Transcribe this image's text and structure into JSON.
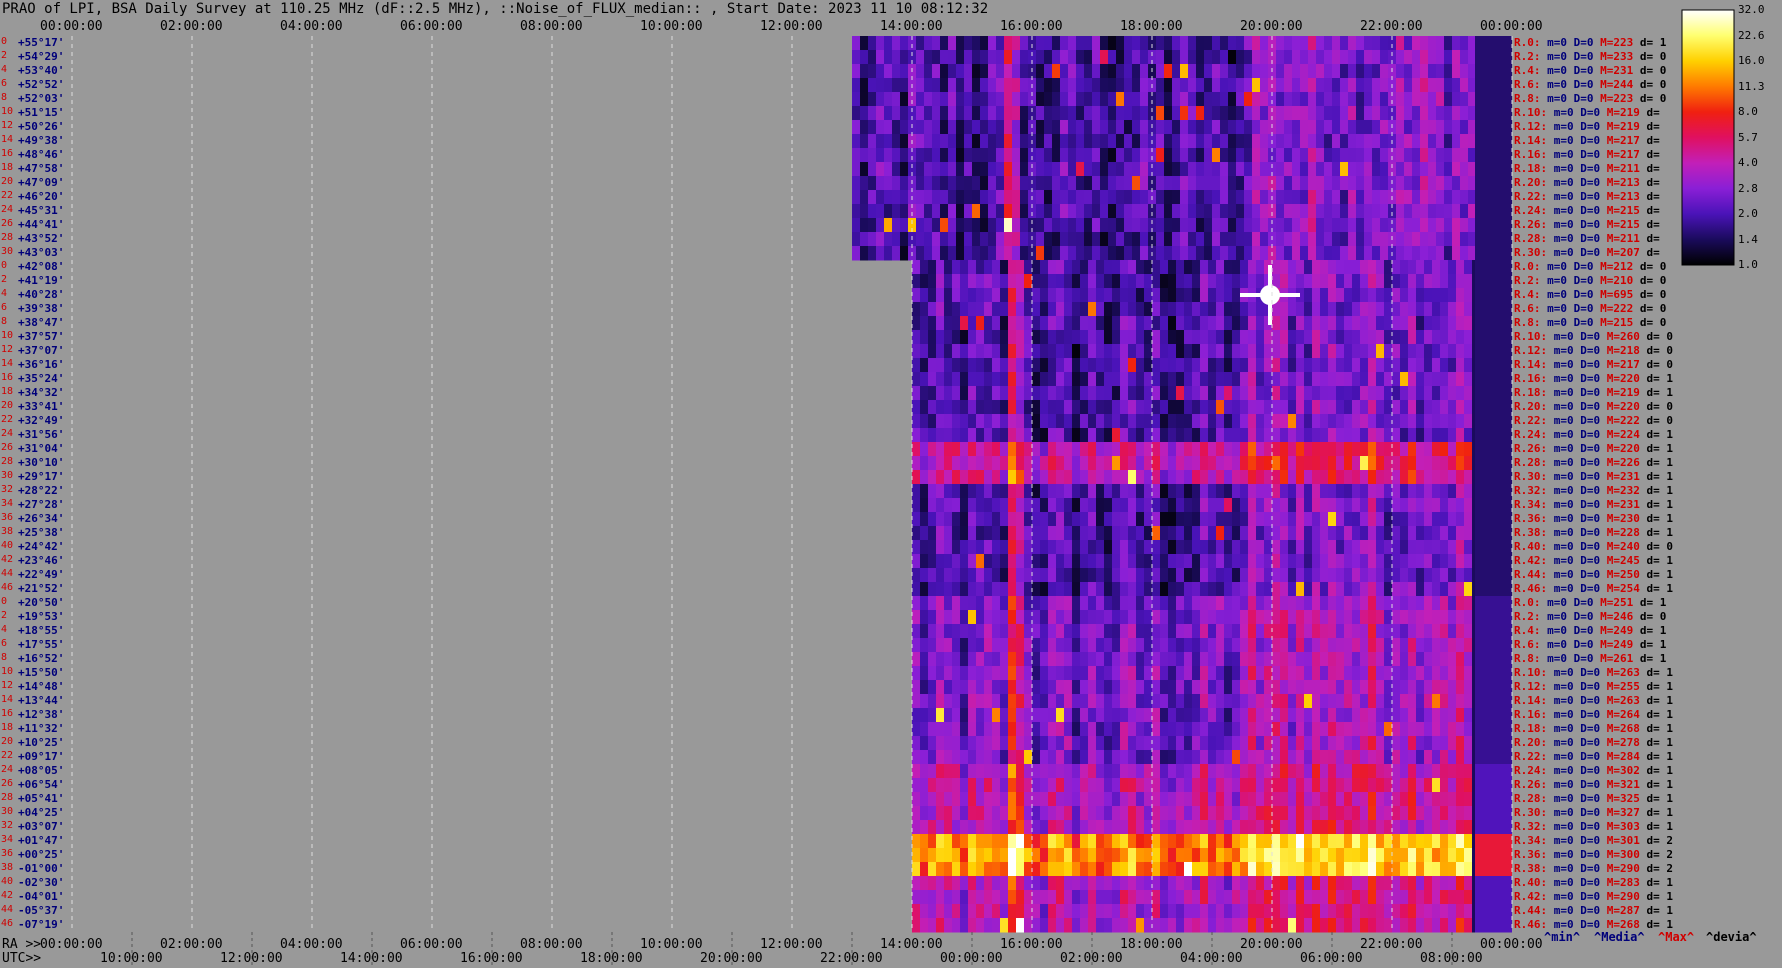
{
  "title": "PRAO of LPI, BSA Daily Survey at 110.25 MHz (dF::2.5 MHz), ::Noise_of_FLUX_median:: , Start Date: 2023 11 10 08:12:32",
  "x_axis": {
    "row1_prefix": "RA >>",
    "row2_prefix": "UTC>>",
    "top_ticks": [
      "00:00:00",
      "02:00:00",
      "04:00:00",
      "06:00:00",
      "08:00:00",
      "10:00:00",
      "12:00:00",
      "14:00:00",
      "16:00:00",
      "18:00:00",
      "20:00:00",
      "22:00:00",
      "00:00:00"
    ],
    "bottom_ra_ticks": [
      "00:00:00",
      "02:00:00",
      "04:00:00",
      "06:00:00",
      "08:00:00",
      "10:00:00",
      "12:00:00",
      "14:00:00",
      "16:00:00",
      "18:00:00",
      "20:00:00",
      "22:00:00",
      "00:00:00"
    ],
    "utc_ticks": [
      "10:00:00",
      "12:00:00",
      "14:00:00",
      "16:00:00",
      "18:00:00",
      "20:00:00",
      "22:00:00",
      "00:00:00",
      "02:00:00",
      "04:00:00",
      "06:00:00",
      "08:00:00"
    ]
  },
  "colorbar": {
    "labels": [
      "32.0",
      "22.6",
      "16.0",
      "11.3",
      "8.0",
      "5.7",
      "4.0",
      "2.8",
      "2.0",
      "1.4",
      "1.0"
    ],
    "stops": [
      "#000000",
      "#1a0b5c",
      "#4a13b8",
      "#8a1fd6",
      "#c21fb8",
      "#e01060",
      "#f02010",
      "#ff7a00",
      "#ffd000",
      "#ffff70",
      "#ffffff"
    ]
  },
  "legend": [
    {
      "text": "^min^",
      "color": "#00007a"
    },
    {
      "text": "^Media^",
      "color": "#00007a"
    },
    {
      "text": "^Max^",
      "color": "#d00000"
    },
    {
      "text": "^devia^",
      "color": "#000000"
    }
  ],
  "chart_data": {
    "type": "heatmap",
    "title": "PRAO of LPI, BSA Daily Survey at 110.25 MHz (dF::2.5 MHz), ::Noise_of_FLUX_median:: , Start Date: 2023 11 10 08:12:32",
    "x_axis": "RA (hh:mm:ss), 00:00:00 to 24:00:00; UTC 08:12:32 (2023-11-10) to 08:12:32 next day",
    "data_start_ra": [
      "13:05:00",
      "14:00:00"
    ],
    "value_range": [
      1.0,
      32.0
    ],
    "colorbar_scale": "log2",
    "rows": [
      {
        "idx": "0",
        "dec": "+55°17'",
        "label": "R.0:",
        "min": 0,
        "med": 0,
        "max": 223,
        "dev": 1
      },
      {
        "idx": "2",
        "dec": "+54°29'",
        "label": "R.2:",
        "min": 0,
        "med": 0,
        "max": 233,
        "dev": 0
      },
      {
        "idx": "4",
        "dec": "+53°40'",
        "label": "R.4:",
        "min": 0,
        "med": 0,
        "max": 231,
        "dev": 0
      },
      {
        "idx": "6",
        "dec": "+52°52'",
        "label": "R.6:",
        "min": 0,
        "med": 0,
        "max": 244,
        "dev": 0
      },
      {
        "idx": "8",
        "dec": "+52°03'",
        "label": "R.8:",
        "min": 0,
        "med": 0,
        "max": 223,
        "dev": 0
      },
      {
        "idx": "10",
        "dec": "+51°15'",
        "label": "R.10:",
        "min": 0,
        "med": 0,
        "max": 219,
        "dev": ""
      },
      {
        "idx": "12",
        "dec": "+50°26'",
        "label": "R.12:",
        "min": 0,
        "med": 0,
        "max": 219,
        "dev": ""
      },
      {
        "idx": "14",
        "dec": "+49°38'",
        "label": "R.14:",
        "min": 0,
        "med": 0,
        "max": 217,
        "dev": ""
      },
      {
        "idx": "16",
        "dec": "+48°46'",
        "label": "R.16:",
        "min": 0,
        "med": 0,
        "max": 217,
        "dev": ""
      },
      {
        "idx": "18",
        "dec": "+47°58'",
        "label": "R.18:",
        "min": 0,
        "med": 0,
        "max": 211,
        "dev": ""
      },
      {
        "idx": "20",
        "dec": "+47°09'",
        "label": "R.20:",
        "min": 0,
        "med": 0,
        "max": 213,
        "dev": ""
      },
      {
        "idx": "22",
        "dec": "+46°20'",
        "label": "R.22:",
        "min": 0,
        "med": 0,
        "max": 213,
        "dev": ""
      },
      {
        "idx": "24",
        "dec": "+45°31'",
        "label": "R.24:",
        "min": 0,
        "med": 0,
        "max": 215,
        "dev": ""
      },
      {
        "idx": "26",
        "dec": "+44°41'",
        "label": "R.26:",
        "min": 0,
        "med": 0,
        "max": 215,
        "dev": ""
      },
      {
        "idx": "28",
        "dec": "+43°52'",
        "label": "R.28:",
        "min": 0,
        "med": 0,
        "max": 211,
        "dev": ""
      },
      {
        "idx": "30",
        "dec": "+43°03'",
        "label": "R.30:",
        "min": 0,
        "med": 0,
        "max": 207,
        "dev": ""
      },
      {
        "idx": "0",
        "dec": "+42°08'",
        "label": "R.0:",
        "min": 0,
        "med": 0,
        "max": 212,
        "dev": 0
      },
      {
        "idx": "2",
        "dec": "+41°19'",
        "label": "R.2:",
        "min": 0,
        "med": 0,
        "max": 210,
        "dev": 0
      },
      {
        "idx": "4",
        "dec": "+40°28'",
        "label": "R.4:",
        "min": 0,
        "med": 0,
        "max": 695,
        "dev": 0
      },
      {
        "idx": "6",
        "dec": "+39°38'",
        "label": "R.6:",
        "min": 0,
        "med": 0,
        "max": 222,
        "dev": 0
      },
      {
        "idx": "8",
        "dec": "+38°47'",
        "label": "R.8:",
        "min": 0,
        "med": 0,
        "max": 215,
        "dev": 0
      },
      {
        "idx": "10",
        "dec": "+37°57'",
        "label": "R.10:",
        "min": 0,
        "med": 0,
        "max": 260,
        "dev": 0
      },
      {
        "idx": "12",
        "dec": "+37°07'",
        "label": "R.12:",
        "min": 0,
        "med": 0,
        "max": 218,
        "dev": 0
      },
      {
        "idx": "14",
        "dec": "+36°16'",
        "label": "R.14:",
        "min": 0,
        "med": 0,
        "max": 217,
        "dev": 0
      },
      {
        "idx": "16",
        "dec": "+35°24'",
        "label": "R.16:",
        "min": 0,
        "med": 0,
        "max": 220,
        "dev": 1
      },
      {
        "idx": "18",
        "dec": "+34°32'",
        "label": "R.18:",
        "min": 0,
        "med": 0,
        "max": 219,
        "dev": 1
      },
      {
        "idx": "20",
        "dec": "+33°41'",
        "label": "R.20:",
        "min": 0,
        "med": 0,
        "max": 220,
        "dev": 0
      },
      {
        "idx": "22",
        "dec": "+32°49'",
        "label": "R.22:",
        "min": 0,
        "med": 0,
        "max": 222,
        "dev": 0
      },
      {
        "idx": "24",
        "dec": "+31°56'",
        "label": "R.24:",
        "min": 0,
        "med": 0,
        "max": 224,
        "dev": 1
      },
      {
        "idx": "26",
        "dec": "+31°04'",
        "label": "R.26:",
        "min": 0,
        "med": 0,
        "max": 220,
        "dev": 1
      },
      {
        "idx": "28",
        "dec": "+30°10'",
        "label": "R.28:",
        "min": 0,
        "med": 0,
        "max": 226,
        "dev": 1
      },
      {
        "idx": "30",
        "dec": "+29°17'",
        "label": "R.30:",
        "min": 0,
        "med": 0,
        "max": 231,
        "dev": 1
      },
      {
        "idx": "32",
        "dec": "+28°22'",
        "label": "R.32:",
        "min": 0,
        "med": 0,
        "max": 232,
        "dev": 1
      },
      {
        "idx": "34",
        "dec": "+27°28'",
        "label": "R.34:",
        "min": 0,
        "med": 0,
        "max": 231,
        "dev": 1
      },
      {
        "idx": "36",
        "dec": "+26°34'",
        "label": "R.36:",
        "min": 0,
        "med": 0,
        "max": 230,
        "dev": 1
      },
      {
        "idx": "38",
        "dec": "+25°38'",
        "label": "R.38:",
        "min": 0,
        "med": 0,
        "max": 228,
        "dev": 1
      },
      {
        "idx": "40",
        "dec": "+24°42'",
        "label": "R.40:",
        "min": 0,
        "med": 0,
        "max": 240,
        "dev": 0
      },
      {
        "idx": "42",
        "dec": "+23°46'",
        "label": "R.42:",
        "min": 0,
        "med": 0,
        "max": 245,
        "dev": 1
      },
      {
        "idx": "44",
        "dec": "+22°49'",
        "label": "R.44:",
        "min": 0,
        "med": 0,
        "max": 250,
        "dev": 1
      },
      {
        "idx": "46",
        "dec": "+21°52'",
        "label": "R.46:",
        "min": 0,
        "med": 0,
        "max": 254,
        "dev": 1
      },
      {
        "idx": "0",
        "dec": "+20°50'",
        "label": "R.0:",
        "min": 0,
        "med": 0,
        "max": 251,
        "dev": 1
      },
      {
        "idx": "2",
        "dec": "+19°53'",
        "label": "R.2:",
        "min": 0,
        "med": 0,
        "max": 246,
        "dev": 0
      },
      {
        "idx": "4",
        "dec": "+18°55'",
        "label": "R.4:",
        "min": 0,
        "med": 0,
        "max": 249,
        "dev": 1
      },
      {
        "idx": "6",
        "dec": "+17°55'",
        "label": "R.6:",
        "min": 0,
        "med": 0,
        "max": 249,
        "dev": 1
      },
      {
        "idx": "8",
        "dec": "+16°52'",
        "label": "R.8:",
        "min": 0,
        "med": 0,
        "max": 261,
        "dev": 1
      },
      {
        "idx": "10",
        "dec": "+15°50'",
        "label": "R.10:",
        "min": 0,
        "med": 0,
        "max": 263,
        "dev": 1
      },
      {
        "idx": "12",
        "dec": "+14°48'",
        "label": "R.12:",
        "min": 0,
        "med": 0,
        "max": 255,
        "dev": 1
      },
      {
        "idx": "14",
        "dec": "+13°44'",
        "label": "R.14:",
        "min": 0,
        "med": 0,
        "max": 263,
        "dev": 1
      },
      {
        "idx": "16",
        "dec": "+12°38'",
        "label": "R.16:",
        "min": 0,
        "med": 0,
        "max": 264,
        "dev": 1
      },
      {
        "idx": "18",
        "dec": "+11°32'",
        "label": "R.18:",
        "min": 0,
        "med": 0,
        "max": 268,
        "dev": 1
      },
      {
        "idx": "20",
        "dec": "+10°25'",
        "label": "R.20:",
        "min": 0,
        "med": 0,
        "max": 278,
        "dev": 1
      },
      {
        "idx": "22",
        "dec": "+09°17'",
        "label": "R.22:",
        "min": 0,
        "med": 0,
        "max": 284,
        "dev": 1
      },
      {
        "idx": "24",
        "dec": "+08°05'",
        "label": "R.24:",
        "min": 0,
        "med": 0,
        "max": 302,
        "dev": 1
      },
      {
        "idx": "26",
        "dec": "+06°54'",
        "label": "R.26:",
        "min": 0,
        "med": 0,
        "max": 321,
        "dev": 1
      },
      {
        "idx": "28",
        "dec": "+05°41'",
        "label": "R.28:",
        "min": 0,
        "med": 0,
        "max": 325,
        "dev": 1
      },
      {
        "idx": "30",
        "dec": "+04°25'",
        "label": "R.30:",
        "min": 0,
        "med": 0,
        "max": 327,
        "dev": 1
      },
      {
        "idx": "32",
        "dec": "+03°07'",
        "label": "R.32:",
        "min": 0,
        "med": 0,
        "max": 303,
        "dev": 1
      },
      {
        "idx": "34",
        "dec": "+01°47'",
        "label": "R.34:",
        "min": 0,
        "med": 0,
        "max": 301,
        "dev": 2
      },
      {
        "idx": "36",
        "dec": "+00°25'",
        "label": "R.36:",
        "min": 0,
        "med": 0,
        "max": 300,
        "dev": 2
      },
      {
        "idx": "38",
        "dec": "-01°00'",
        "label": "R.38:",
        "min": 0,
        "med": 0,
        "max": 290,
        "dev": 2
      },
      {
        "idx": "40",
        "dec": "-02°30'",
        "label": "R.40:",
        "min": 0,
        "med": 0,
        "max": 283,
        "dev": 1
      },
      {
        "idx": "42",
        "dec": "-04°01'",
        "label": "R.42:",
        "min": 0,
        "med": 0,
        "max": 290,
        "dev": 1
      },
      {
        "idx": "44",
        "dec": "-05°37'",
        "label": "R.44:",
        "min": 0,
        "med": 0,
        "max": 287,
        "dev": 1
      },
      {
        "idx": "46",
        "dec": "-07°19'",
        "label": "R.46:",
        "min": 0,
        "med": 0,
        "max": 268,
        "dev": 1
      }
    ]
  }
}
